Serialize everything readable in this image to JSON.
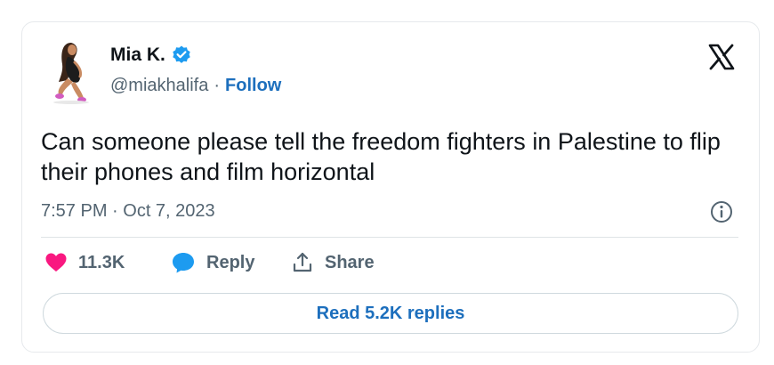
{
  "author": {
    "display_name": "Mia K.",
    "handle": "@miakhalifa",
    "separator": "·",
    "follow_label": "Follow",
    "verified_icon": "verified-badge-icon",
    "verified_color": "#1d9bf0"
  },
  "logo_icon": "x-logo-icon",
  "tweet": {
    "text": "Can someone please tell the freedom fighters in Palestine to flip their phones and film horizontal",
    "timestamp": "7:57 PM · Oct 7, 2023"
  },
  "actions": {
    "likes_count": "11.3K",
    "like_color": "#f91880",
    "reply_label": "Reply",
    "reply_color": "#1d9bf0",
    "share_label": "Share"
  },
  "read_replies_label": "Read 5.2K replies",
  "colors": {
    "link": "#1d6fbd",
    "secondary_text": "#536471",
    "primary_text": "#0f1419",
    "border": "#e6e9ec"
  }
}
